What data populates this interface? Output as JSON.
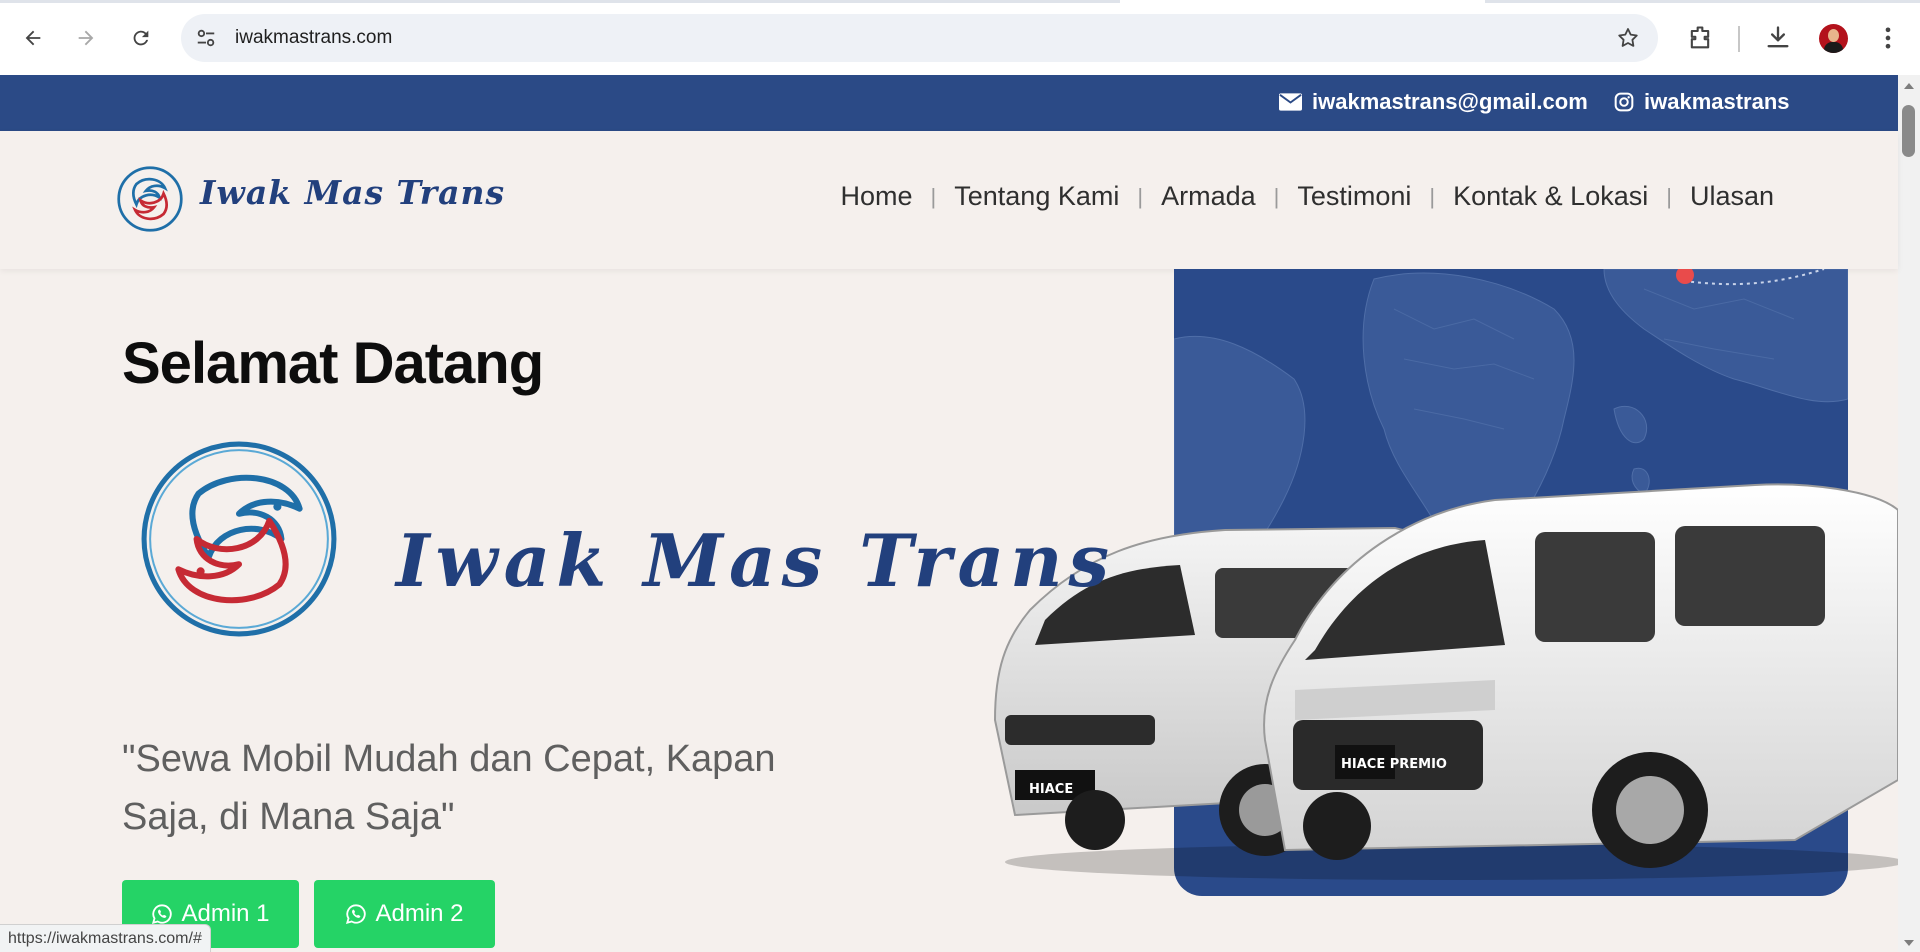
{
  "browser": {
    "url": "iwakmastrans.com",
    "status_url": "https://iwakmastrans.com/#",
    "icons": [
      "back-icon",
      "forward-icon",
      "reload-icon",
      "site-settings-icon",
      "bookmark-star-icon",
      "extensions-icon",
      "download-icon",
      "profile-avatar",
      "more-menu-icon"
    ]
  },
  "topbar": {
    "email": "iwakmastrans@gmail.com",
    "instagram": "iwakmastrans",
    "background": "#2b4a86"
  },
  "header": {
    "brand": "Iwak Mas Trans",
    "nav": {
      "home": "Home",
      "about": "Tentang Kami",
      "fleet": "Armada",
      "testimonials": "Testimoni",
      "contact": "Kontak & Lokasi",
      "reviews": "Ulasan",
      "separator": "|"
    }
  },
  "hero": {
    "title": "Selamat Datang",
    "brand": "Iwak Mas Trans",
    "tagline": "\"Sewa Mobil Mudah dan Cepat, Kapan Saja, di Mana Saja\"",
    "buttons": {
      "admin1": "Admin 1",
      "admin2": "Admin 2"
    },
    "van_badges": [
      "HIACE",
      "HIACE PREMIO"
    ],
    "colors": {
      "brand_blue": "#22407d",
      "whatsapp_green": "#25d366",
      "map_blue": "#2a4a8a"
    }
  }
}
